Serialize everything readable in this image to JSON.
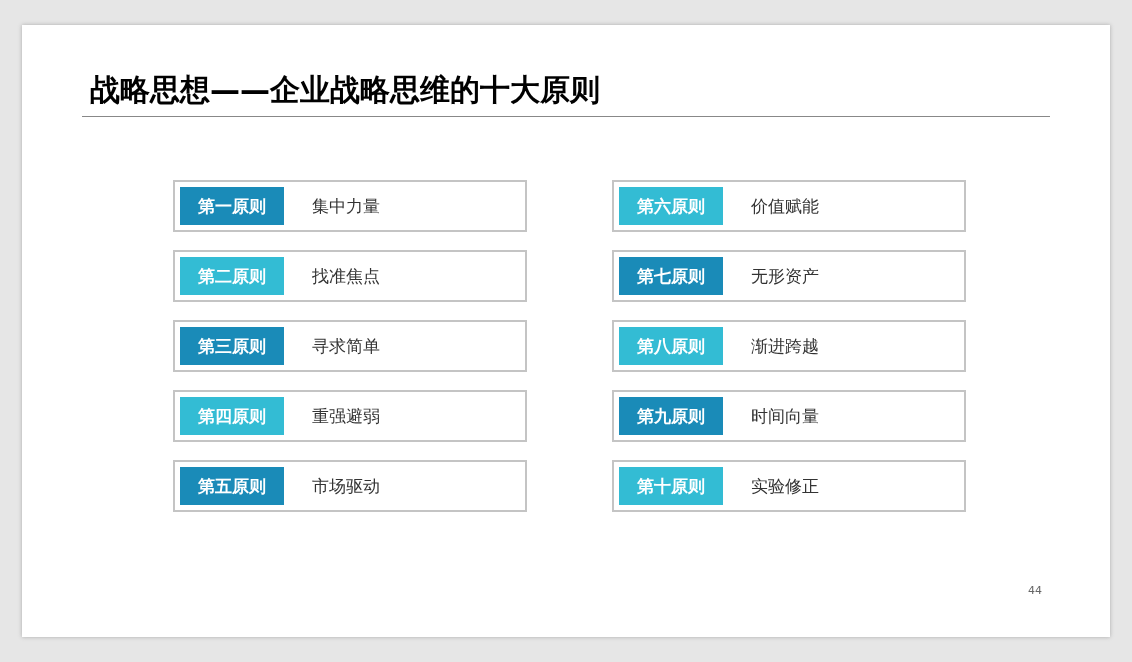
{
  "slide": {
    "title": "战略思想——企业战略思维的十大原则",
    "page_number": "44",
    "columns": [
      [
        {
          "label": "第一原则",
          "text": "集中力量",
          "color": "#1a8bb8"
        },
        {
          "label": "第二原则",
          "text": "找准焦点",
          "color": "#33bcd4"
        },
        {
          "label": "第三原则",
          "text": "寻求简单",
          "color": "#1a8bb8"
        },
        {
          "label": "第四原则",
          "text": "重强避弱",
          "color": "#33bcd4"
        },
        {
          "label": "第五原则",
          "text": "市场驱动",
          "color": "#1a8bb8"
        }
      ],
      [
        {
          "label": "第六原则",
          "text": "价值赋能",
          "color": "#33bcd4"
        },
        {
          "label": "第七原则",
          "text": "无形资产",
          "color": "#1a8bb8"
        },
        {
          "label": "第八原则",
          "text": "渐进跨越",
          "color": "#33bcd4"
        },
        {
          "label": "第九原则",
          "text": "时间向量",
          "color": "#1a8bb8"
        },
        {
          "label": "第十原则",
          "text": "实验修正",
          "color": "#33bcd4"
        }
      ]
    ]
  }
}
